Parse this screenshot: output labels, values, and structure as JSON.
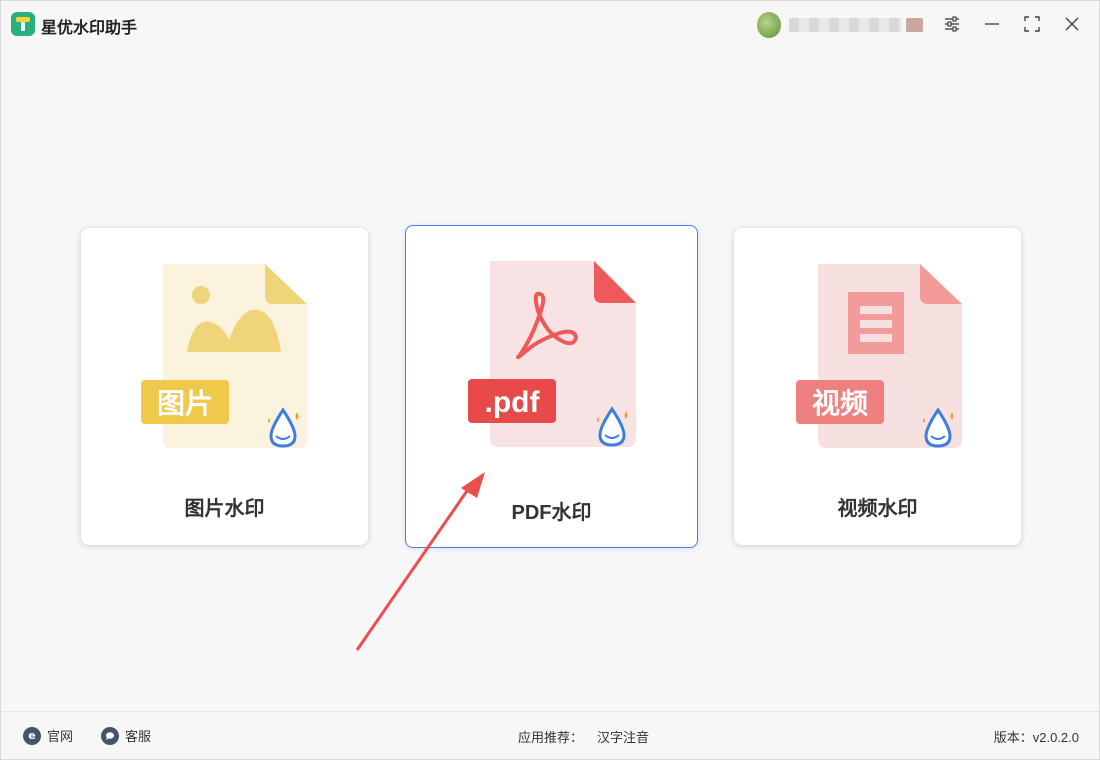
{
  "app": {
    "title": "星优水印助手"
  },
  "cards": [
    {
      "label": "图片水印",
      "badge": "图片",
      "icon": "image-file-icon",
      "color": "#f0c84a"
    },
    {
      "label": "PDF水印",
      "badge": ".pdf",
      "icon": "pdf-file-icon",
      "color": "#e84a4a"
    },
    {
      "label": "视频水印",
      "badge": "视频",
      "icon": "video-file-icon",
      "color": "#ee8080"
    }
  ],
  "footer": {
    "website": "官网",
    "support": "客服",
    "recommend_label": "应用推荐：",
    "recommend_link": "汉字注音",
    "version": "版本：v2.0.2.0"
  },
  "colors": {
    "accent": "#4a7de8",
    "arrow": "#ec4d4d"
  }
}
